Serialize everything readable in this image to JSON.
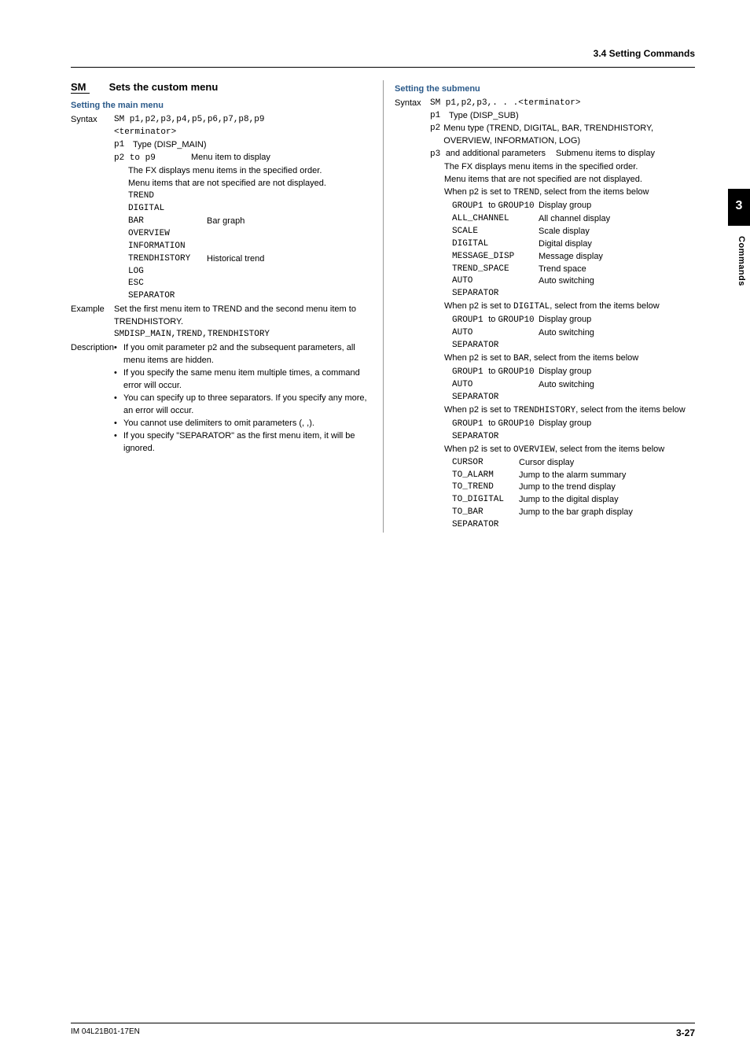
{
  "header": {
    "section": "3.4  Setting Commands"
  },
  "sidetab": {
    "chapter_num": "3",
    "label": "Commands"
  },
  "footer": {
    "left": "IM 04L21B01-17EN",
    "right": "3-27"
  },
  "left": {
    "cmd": "SM",
    "cmd_title": "Sets the custom menu",
    "subhead": "Setting the main menu",
    "syntax_label": "Syntax",
    "syntax_line1": "SM p1,p2,p3,p4,p5,p6,p7,p8,p9",
    "syntax_line2": "<terminator>",
    "p1_key": "p1",
    "p1_val": "Type (DISP_MAIN)",
    "p2top9_key": "p2 to p9",
    "p2top9_val": "Menu item to display",
    "p_note1": "The FX displays menu items in the specified order.",
    "p_note2": "Menu items that are not specified are not displayed.",
    "items": {
      "trend": "TREND",
      "digital": "DIGITAL",
      "bar_k": "BAR",
      "bar_v": "Bar graph",
      "overview": "OVERVIEW",
      "information": "INFORMATION",
      "th_k": "TRENDHISTORY",
      "th_v": "Historical trend",
      "log": "LOG",
      "esc": "ESC",
      "sep": "SEPARATOR"
    },
    "example_label": "Example",
    "example_text": "Set the first menu item to TREND and the second menu item to TRENDHISTORY.",
    "example_code": "SMDISP_MAIN,TREND,TRENDHISTORY",
    "desc_label": "Description",
    "bullets": [
      "If you omit parameter p2 and the subsequent parameters, all menu items are hidden.",
      "If you specify the same menu item multiple times, a command error will occur.",
      "You can specify up to three separators. If you specify any more, an error will occur.",
      "You cannot use delimiters to omit parameters (, ,).",
      "If you specify \"SEPARATOR\" as the first menu item, it will be ignored."
    ]
  },
  "right": {
    "subhead": "Setting the submenu",
    "syntax_label": "Syntax",
    "syntax_line": "SM p1,p2,p3,. . .<terminator>",
    "p1_key": "p1",
    "p1_val": "Type (DISP_SUB)",
    "p2_key": "p2",
    "p2_val": "Menu type (TREND, DIGITAL, BAR, TRENDHISTORY, OVERVIEW, INFORMATION, LOG)",
    "p3_key": "p3 ",
    "p3_extra": "and additional parameters",
    "p3_val": "Submenu items to display",
    "note1": "The FX displays menu items in the specified order.",
    "note2": "Menu items that are not specified are not displayed.",
    "trend_intro_a": "When p2 is set to ",
    "trend_intro_code": "TREND",
    "trend_intro_b": ", select from the items below",
    "group_k": "GROUP1 ",
    "group_to": "to ",
    "group_k2": "GROUP10",
    "group_v": "Display group",
    "allch_k": "ALL_CHANNEL",
    "allch_v": "All channel display",
    "scale_k": "SCALE",
    "scale_v": "Scale display",
    "digital_k": "DIGITAL",
    "digital_v": "Digital display",
    "msg_k": "MESSAGE_DISP",
    "msg_v": "Message display",
    "tspace_k": "TREND_SPACE",
    "tspace_v": "Trend space",
    "auto_k": "AUTO",
    "auto_v": "Auto switching",
    "sep_k": "SEPARATOR",
    "digital_intro_a": "When p2 is set to ",
    "digital_intro_code": "DIGITAL",
    "digital_intro_b": ", select from the items below",
    "bar_intro_a": "When p2 is set to ",
    "bar_intro_code": "BAR",
    "bar_intro_b": ", select from the items below",
    "th_intro_a": "When p2 is set to ",
    "th_intro_code": "TRENDHISTORY",
    "th_intro_b": ", select from the items below",
    "ov_intro_a": "When p2 is set to ",
    "ov_intro_code": "OVERVIEW",
    "ov_intro_b": ", select from the items below",
    "cursor_k": "CURSOR",
    "cursor_v": "Cursor display",
    "toalarm_k": "TO_ALARM",
    "toalarm_v": "Jump to the alarm summary",
    "totrend_k": "TO_TREND",
    "totrend_v": "Jump to the trend display",
    "todig_k": "TO_DIGITAL",
    "todig_v": "Jump to the digital display",
    "tobar_k": "TO_BAR",
    "tobar_v": "Jump to the bar graph display"
  }
}
